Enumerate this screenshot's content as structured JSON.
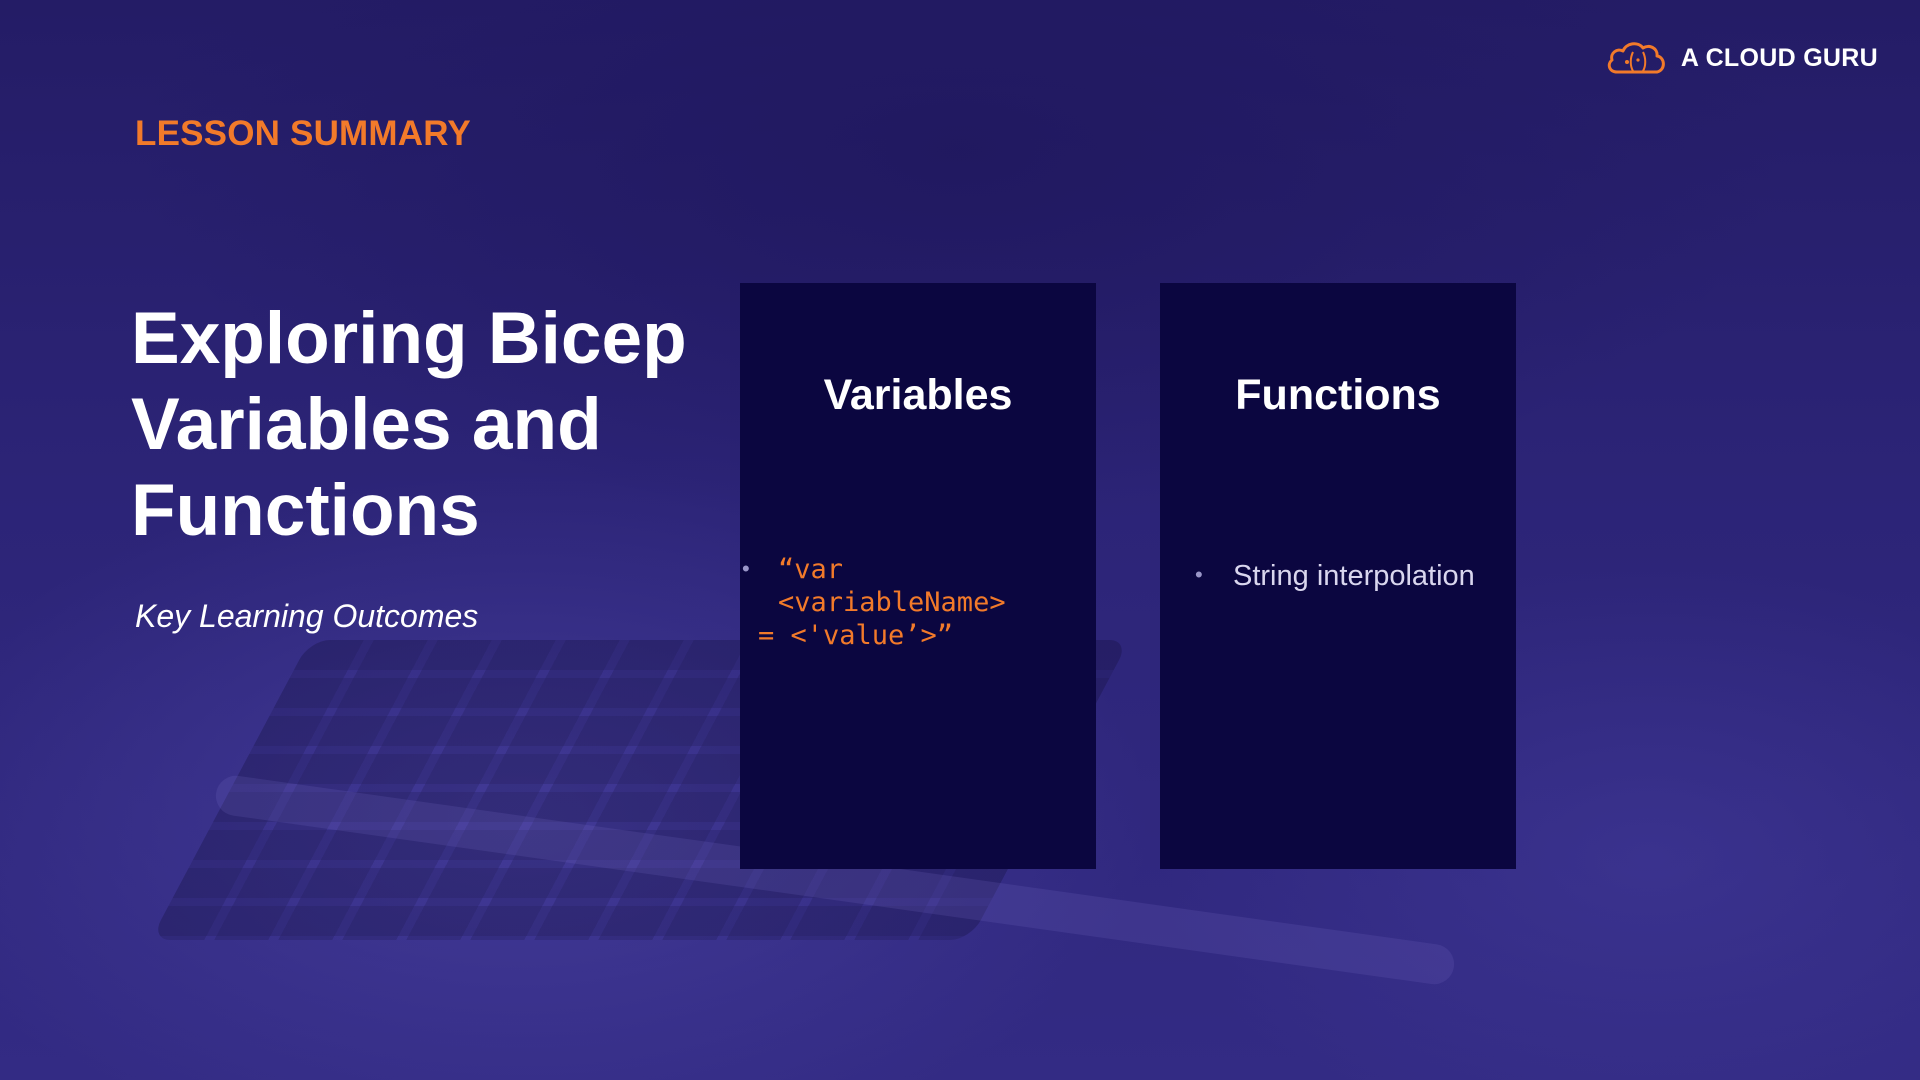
{
  "brand": {
    "name": "A CLOUD GURU",
    "icon": "cloud-logo-icon",
    "accent_color": "#f27a2a"
  },
  "slide": {
    "eyebrow": "LESSON SUMMARY",
    "title_lines": [
      "Exploring Bicep",
      "Variables and",
      "Functions"
    ],
    "subtitle": "Key Learning Outcomes"
  },
  "cards": [
    {
      "title": "Variables",
      "items": [
        {
          "line1": "“var <variableName>",
          "line2": "= <'value’>”"
        }
      ]
    },
    {
      "title": "Functions",
      "items": [
        {
          "text": "String interpolation"
        }
      ]
    }
  ],
  "colors": {
    "background": "#2a2170",
    "card": "#0b0640",
    "text": "#ffffff",
    "accent": "#f27a2a"
  }
}
